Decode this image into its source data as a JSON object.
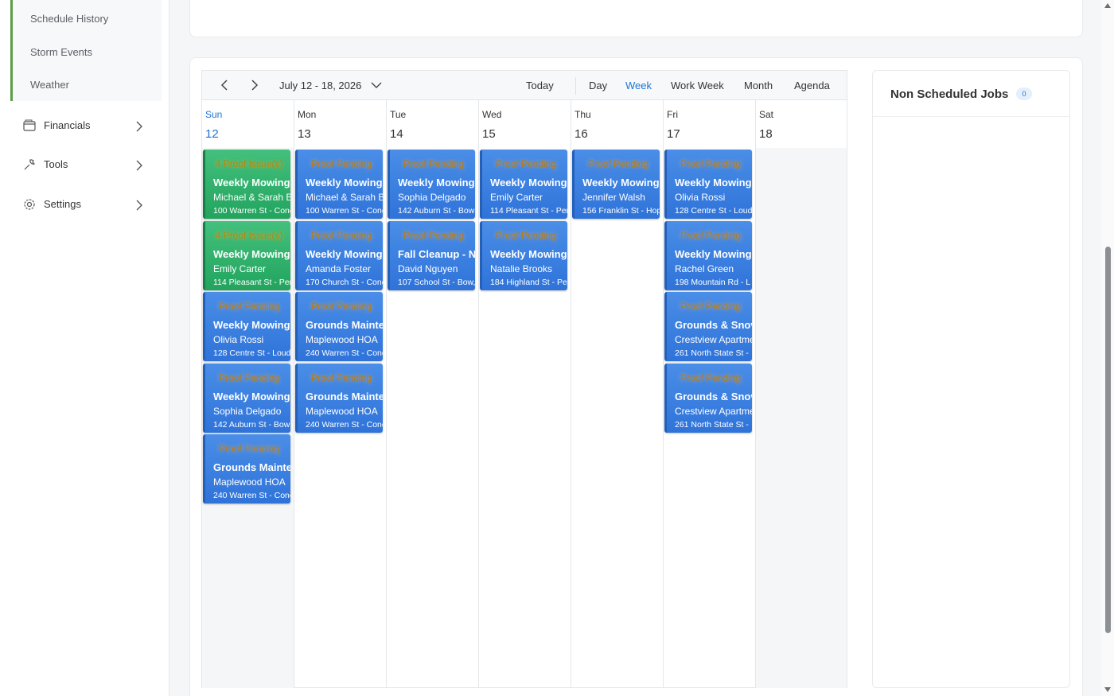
{
  "sidebar": {
    "sub_items": [
      {
        "label": "Schedule History"
      },
      {
        "label": "Storm Events"
      },
      {
        "label": "Weather"
      }
    ],
    "items": [
      {
        "label": "Financials",
        "icon": "wallet-icon"
      },
      {
        "label": "Tools",
        "icon": "wrench-icon"
      },
      {
        "label": "Settings",
        "icon": "gear-icon"
      }
    ]
  },
  "toolbar": {
    "date_range": "July 12 - 18, 2026",
    "today": "Today",
    "views": [
      "Day",
      "Week",
      "Work Week",
      "Month",
      "Agenda"
    ],
    "active_view": "Week"
  },
  "calendar": {
    "days": [
      {
        "name": "Sun",
        "num": "12"
      },
      {
        "name": "Mon",
        "num": "13"
      },
      {
        "name": "Tue",
        "num": "14"
      },
      {
        "name": "Wed",
        "num": "15"
      },
      {
        "name": "Thu",
        "num": "16"
      },
      {
        "name": "Fri",
        "num": "17"
      },
      {
        "name": "Sat",
        "num": "18"
      }
    ],
    "events": {
      "sun": [
        {
          "badge": "4 Proof Issue(s)",
          "title": "Weekly Mowing",
          "client": "Michael & Sarah Be",
          "addr": "100 Warren St - Conc",
          "color": "green"
        },
        {
          "badge": "4 Proof Issue(s)",
          "title": "Weekly Mowing",
          "client": "Emily Carter",
          "addr": "114 Pleasant St - Per",
          "color": "green"
        },
        {
          "badge": "Proof Pending",
          "title": "Weekly Mowing",
          "client": "Olivia Rossi",
          "addr": "128 Centre St - Loud",
          "color": "blue"
        },
        {
          "badge": "Proof Pending",
          "title": "Weekly Mowing",
          "client": "Sophia Delgado",
          "addr": "142 Auburn St - Bow",
          "color": "blue"
        },
        {
          "badge": "Proof Pending",
          "title": "Grounds Mainte",
          "client": "Maplewood HOA",
          "addr": "240 Warren St - Conc",
          "color": "blue"
        }
      ],
      "mon": [
        {
          "badge": "Proof Pending",
          "title": "Weekly Mowing",
          "client": "Michael & Sarah Be",
          "addr": "100 Warren St - Conc",
          "color": "blue"
        },
        {
          "badge": "Proof Pending",
          "title": "Weekly Mowing",
          "client": "Amanda Foster",
          "addr": "170 Church St - Conc",
          "color": "blue"
        },
        {
          "badge": "Proof Pending",
          "title": "Grounds Mainte",
          "client": "Maplewood HOA",
          "addr": "240 Warren St - Conc",
          "color": "blue"
        },
        {
          "badge": "Proof Pending",
          "title": "Grounds Mainte",
          "client": "Maplewood HOA",
          "addr": "240 Warren St - Conc",
          "color": "blue"
        }
      ],
      "tue": [
        {
          "badge": "Proof Pending",
          "title": "Weekly Mowing",
          "client": "Sophia Delgado",
          "addr": "142 Auburn St - Bow",
          "color": "blue"
        },
        {
          "badge": "Proof Pending",
          "title": "Fall Cleanup - N",
          "client": "David Nguyen",
          "addr": "107 School St - Bow,",
          "color": "blue"
        }
      ],
      "wed": [
        {
          "badge": "Proof Pending",
          "title": "Weekly Mowing",
          "client": "Emily Carter",
          "addr": "114 Pleasant St - Per",
          "color": "blue"
        },
        {
          "badge": "Proof Pending",
          "title": "Weekly Mowing",
          "client": "Natalie Brooks",
          "addr": "184 Highland St - Pe",
          "color": "blue"
        }
      ],
      "thu": [
        {
          "badge": "Proof Pending",
          "title": "Weekly Mowing",
          "client": "Jennifer Walsh",
          "addr": "156 Franklin St - Hop",
          "color": "blue"
        }
      ],
      "fri": [
        {
          "badge": "Proof Pending",
          "title": "Weekly Mowing",
          "client": "Olivia Rossi",
          "addr": "128 Centre St - Loud",
          "color": "blue"
        },
        {
          "badge": "Proof Pending",
          "title": "Weekly Mowing",
          "client": "Rachel Green",
          "addr": "198 Mountain Rd - L",
          "color": "blue"
        },
        {
          "badge": "Proof Pending",
          "title": "Grounds & Snov",
          "client": "Crestview Apartmen",
          "addr": "261 North State St -",
          "color": "blue"
        },
        {
          "badge": "Proof Pending",
          "title": "Grounds & Snov",
          "client": "Crestview Apartmen",
          "addr": "261 North State St -",
          "color": "blue"
        }
      ]
    }
  },
  "non_scheduled": {
    "title": "Non Scheduled Jobs",
    "count": "0"
  },
  "colors": {
    "accent": "#1f73d6",
    "event_blue": "#2f73d9",
    "event_green": "#22a45e",
    "sidebar_accent": "#5c9d48"
  }
}
